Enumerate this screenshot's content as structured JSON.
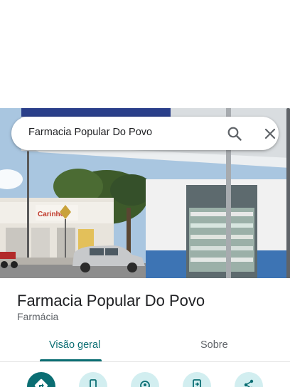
{
  "search": {
    "query": "Farmacia Popular Do Povo",
    "search_icon": "search-icon",
    "close_icon": "close-icon"
  },
  "photo": {
    "sign_text": "Carinho"
  },
  "place": {
    "name": "Farmacia Popular Do Povo",
    "category": "Farmácia"
  },
  "tabs": [
    {
      "label": "Visão geral",
      "selected": true
    },
    {
      "label": "Sobre",
      "selected": false
    }
  ],
  "actions": [
    {
      "icon": "directions-icon"
    },
    {
      "icon": "phone-icon"
    },
    {
      "icon": "nearby-icon"
    },
    {
      "icon": "send-to-phone-icon"
    },
    {
      "icon": "share-icon"
    }
  ],
  "colors": {
    "accent": "#0b6e73",
    "accent_light": "#d2eef0",
    "text_primary": "#202124",
    "text_secondary": "#5f6368"
  }
}
